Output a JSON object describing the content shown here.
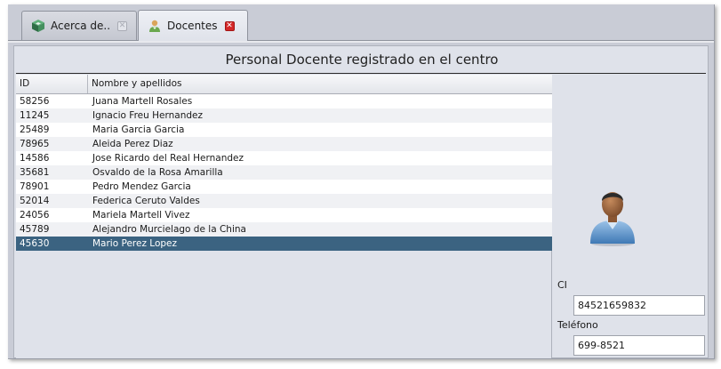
{
  "tabs": [
    {
      "label": "Acerca de..",
      "icon": "cube-icon",
      "active": false
    },
    {
      "label": "Docentes",
      "icon": "teacher-user-icon",
      "active": true
    }
  ],
  "panel": {
    "title": "Personal Docente registrado en el centro"
  },
  "table": {
    "columns": [
      "ID",
      "Nombre y apellidos"
    ],
    "rows": [
      {
        "id": "58256",
        "name": "Juana Martell Rosales"
      },
      {
        "id": "11245",
        "name": "Ignacio Freu Hernandez"
      },
      {
        "id": "25489",
        "name": "Maria Garcia Garcia"
      },
      {
        "id": "78965",
        "name": "Aleida Perez Diaz"
      },
      {
        "id": "14586",
        "name": "Jose Ricardo del Real Hernandez"
      },
      {
        "id": "35681",
        "name": "Osvaldo de la Rosa Amarilla"
      },
      {
        "id": "78901",
        "name": "Pedro Mendez Garcia"
      },
      {
        "id": "52014",
        "name": "Federica Ceruto Valdes"
      },
      {
        "id": "24056",
        "name": "Mariela Martell Vivez"
      },
      {
        "id": "45789",
        "name": "Alejandro Murcielago de la China"
      },
      {
        "id": "45630",
        "name": "Mario Perez Lopez",
        "selected": true
      }
    ]
  },
  "details": {
    "avatar_icon": "user-avatar-icon",
    "ci_label": "CI",
    "ci_value": "84521659832",
    "phone_label": "Teléfono",
    "phone_value": "699-8521"
  },
  "colors": {
    "selected_row": "#3b6381",
    "close_active": "#d42828"
  }
}
